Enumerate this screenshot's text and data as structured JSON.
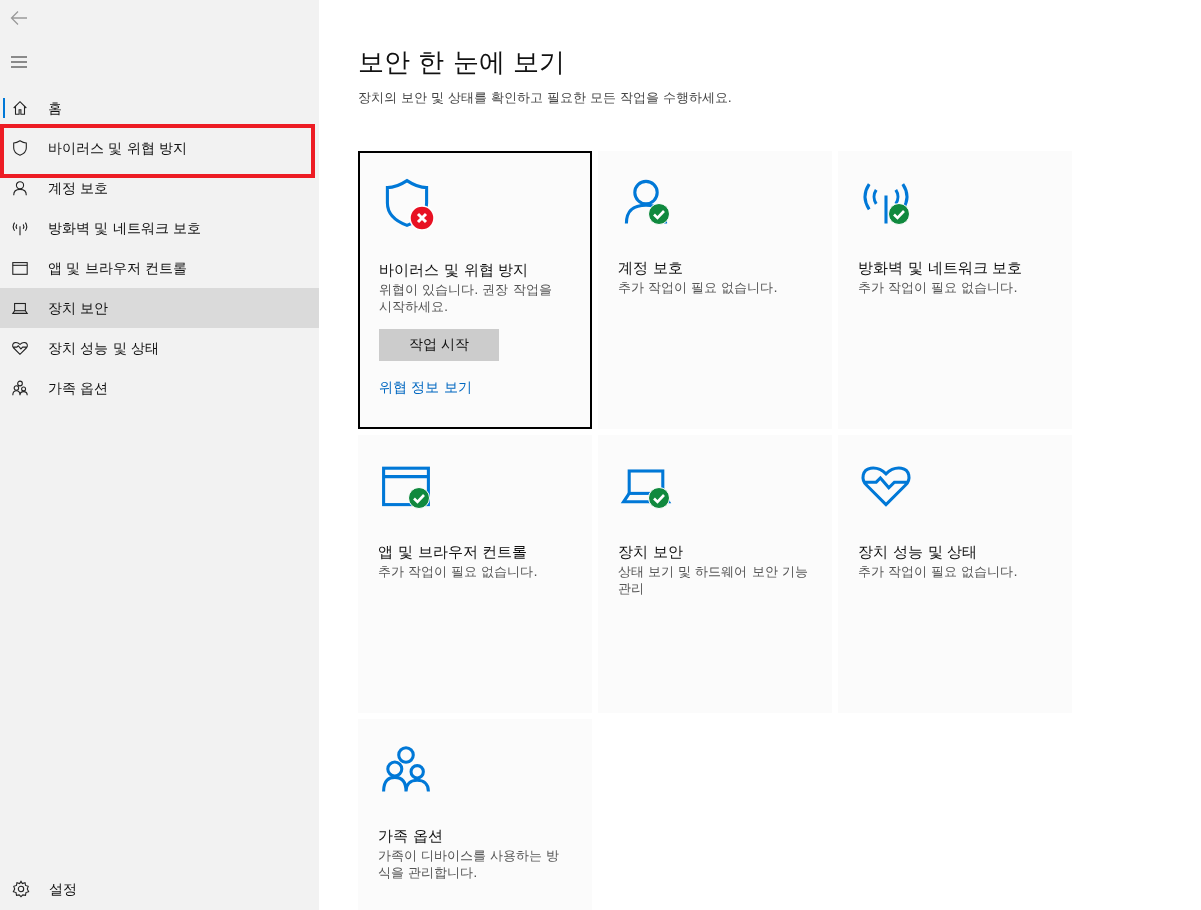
{
  "sidebar": {
    "items": [
      {
        "label": "홈",
        "kind": "home",
        "selected": true,
        "hovered": false,
        "highlighted": false
      },
      {
        "label": "바이러스 및 위협 방지",
        "kind": "shield",
        "selected": false,
        "hovered": false,
        "highlighted": true
      },
      {
        "label": "계정 보호",
        "kind": "person",
        "selected": false,
        "hovered": false,
        "highlighted": false
      },
      {
        "label": "방화벽 및 네트워크 보호",
        "kind": "antenna",
        "selected": false,
        "hovered": false,
        "highlighted": false
      },
      {
        "label": "앱 및 브라우저 컨트롤",
        "kind": "window",
        "selected": false,
        "hovered": false,
        "highlighted": false
      },
      {
        "label": "장치 보안",
        "kind": "laptop",
        "selected": false,
        "hovered": true,
        "highlighted": false
      },
      {
        "label": "장치 성능 및 상태",
        "kind": "heart",
        "selected": false,
        "hovered": false,
        "highlighted": false
      },
      {
        "label": "가족 옵션",
        "kind": "family",
        "selected": false,
        "hovered": false,
        "highlighted": false
      }
    ],
    "settings": "설정"
  },
  "main": {
    "title": "보안 한 눈에 보기",
    "subtitle": "장치의 보안 및 상태를 확인하고 필요한 모든 작업을 수행하세요.",
    "cards": [
      {
        "title": "바이러스 및 위협 방지",
        "description": "위협이 있습니다. 권장 작업을 시작하세요.",
        "kind": "shield",
        "threat": true,
        "ok": false,
        "focused": true,
        "button": "작업 시작",
        "link": "위협 정보 보기"
      },
      {
        "title": "계정 보호",
        "description": "추가 작업이 필요 없습니다.",
        "kind": "person",
        "threat": false,
        "ok": true,
        "focused": false
      },
      {
        "title": "방화벽 및 네트워크 보호",
        "description": "추가 작업이 필요 없습니다.",
        "kind": "antenna",
        "threat": false,
        "ok": true,
        "focused": false
      },
      {
        "title": "앱 및 브라우저 컨트롤",
        "description": "추가 작업이 필요 없습니다.",
        "kind": "window",
        "threat": false,
        "ok": true,
        "focused": false
      },
      {
        "title": "장치 보안",
        "description": "상태 보기 및 하드웨어 보안 기능 관리",
        "kind": "laptop",
        "threat": false,
        "ok": true,
        "focused": false
      },
      {
        "title": "장치 성능 및 상태",
        "description": "추가 작업이 필요 없습니다.",
        "kind": "heart",
        "threat": false,
        "ok": false,
        "focused": false
      },
      {
        "title": "가족 옵션",
        "description": "가족이 디바이스를 사용하는 방식을 관리합니다.",
        "kind": "family",
        "threat": false,
        "ok": false,
        "focused": false
      }
    ]
  }
}
